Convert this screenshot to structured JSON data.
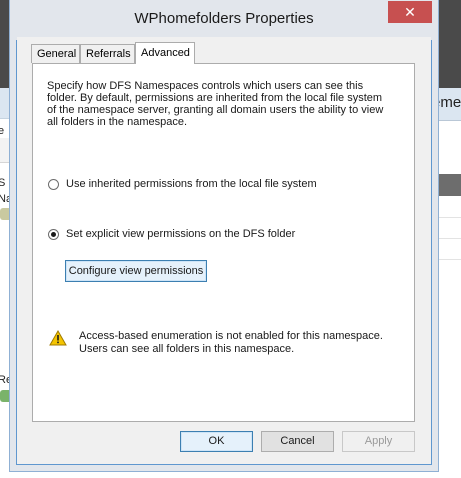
{
  "background": {
    "right_header_text": "ement",
    "left_texts": [
      "e",
      "S M",
      "Na",
      "Re"
    ]
  },
  "dialog": {
    "title": "WPhomefolders Properties",
    "close_glyph": "✕",
    "tabs": [
      {
        "label": "General",
        "active": false
      },
      {
        "label": "Referrals",
        "active": false
      },
      {
        "label": "Advanced",
        "active": true
      }
    ],
    "description": "Specify how DFS Namespaces controls which users can see this folder. By default, permissions are inherited from the local file system of the namespace server, granting all domain users the ability to view all folders in the namespace.",
    "options": [
      {
        "label": "Use inherited permissions from the local file system",
        "checked": false
      },
      {
        "label": "Set explicit view permissions on the DFS folder",
        "checked": true
      }
    ],
    "configure_button": "Configure view permissions",
    "warning_icon": "warning-triangle-icon",
    "warning_text": "Access-based enumeration is not enabled for this namespace. Users can see all folders in this namespace.",
    "buttons": {
      "ok": "OK",
      "cancel": "Cancel",
      "apply": "Apply"
    },
    "colors": {
      "accent_border": "#3c7fb1",
      "close_button": "#c75050",
      "warning_fill": "#f4c400"
    }
  }
}
